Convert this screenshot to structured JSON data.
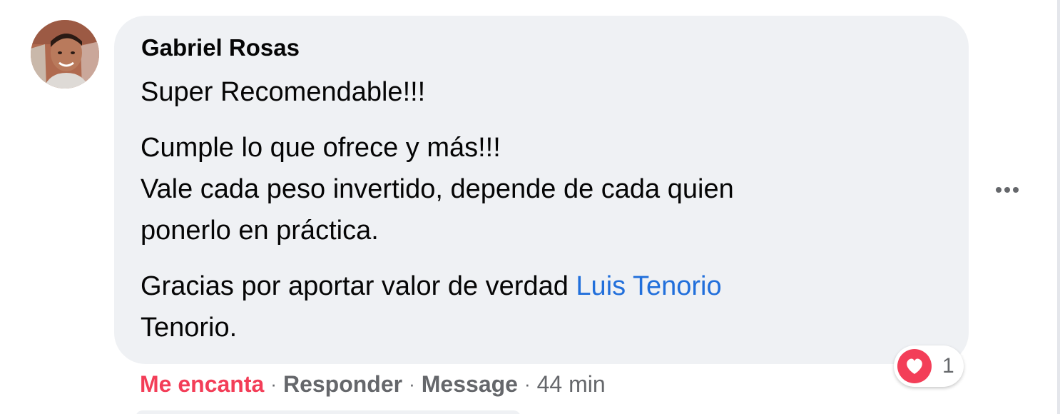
{
  "comment": {
    "author": "Gabriel Rosas",
    "lines": [
      "Super Recomendable!!!",
      "Cumple lo que ofrece y más!!!",
      "Vale cada peso invertido, depende de cada quien",
      "ponerlo en práctica."
    ],
    "closing_text": "Gracias por aportar valor de verdad ",
    "mention": "Luis Tenorio",
    "closing_tail": "Tenorio."
  },
  "actions": {
    "love_label": "Me encanta",
    "reply_label": "Responder",
    "message_label": "Message",
    "separator": "·",
    "time": "44 min"
  },
  "reactions": {
    "icon": "heart-icon",
    "count": "1"
  },
  "more_icon": "more-options-icon",
  "colors": {
    "bubble": "#eff1f4",
    "love": "#f33e58",
    "mention": "#216fdb",
    "secondary_text": "#65676b"
  }
}
